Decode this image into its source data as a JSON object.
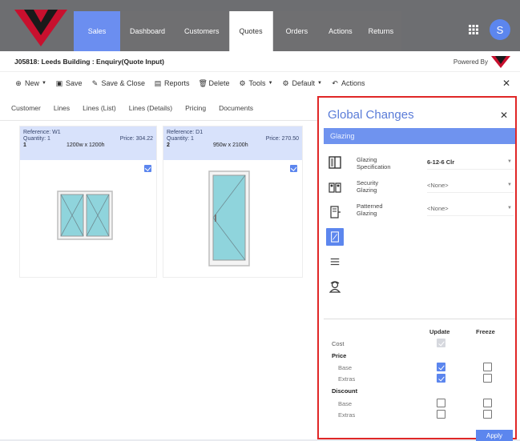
{
  "app": {
    "logo_icon": "company-logo",
    "nav_tabs": [
      "Sales",
      "Dashboard",
      "Customers",
      "Quotes",
      "Orders",
      "Actions",
      "Returns"
    ],
    "active_tab": "Quotes",
    "apps_icon": "grid-icon",
    "avatar_initial": "S",
    "accent_color": "#5c86ee"
  },
  "header": {
    "title": "J05818: Leeds Building : Enquiry(Quote Input)",
    "powered_by": "Powered By"
  },
  "toolbar": {
    "new": "New",
    "save": "Save",
    "save_close": "Save & Close",
    "reports": "Reports",
    "delete": "Delete",
    "tools": "Tools",
    "default": "Default",
    "actions": "Actions"
  },
  "subtabs": [
    "Customer",
    "Lines",
    "Lines (List)",
    "Lines (Details)",
    "Pricing",
    "Documents"
  ],
  "lines": [
    {
      "reference": "Reference: W1",
      "quantity": "Quantity: 1",
      "price": "Price: 304.22",
      "number": "1",
      "size": "1200w x 1200h",
      "selected": true
    },
    {
      "reference": "Reference: D1",
      "quantity": "Quantity: 1",
      "price": "Price: 270.50",
      "number": "2",
      "size": "950w x 2100h",
      "selected": true
    }
  ],
  "panel": {
    "title": "Global Changes",
    "section": "Glazing",
    "options": [
      {
        "label1": "Glazing",
        "label2": "Specification",
        "value": "6-12-6 Clr",
        "bold": true
      },
      {
        "label1": "Security",
        "label2": "Glazing",
        "value": "<None>",
        "bold": false
      },
      {
        "label1": "Patterned",
        "label2": "Glazing",
        "value": "<None>",
        "bold": false
      }
    ],
    "rail_icons": [
      "glazing-icon",
      "security-glazing-icon",
      "patterned-glazing-icon",
      "selected-option-icon",
      "list-icon",
      "fitter-icon"
    ],
    "col_update": "Update",
    "col_freeze": "Freeze",
    "rows": {
      "cost": "Cost",
      "price": "Price",
      "base1": "Base",
      "extras1": "Extras",
      "discount": "Discount",
      "base2": "Base",
      "extras2": "Extras"
    },
    "checks": {
      "cost_update": "disabled",
      "price_base_update": true,
      "price_base_freeze": false,
      "price_extras_update": true,
      "price_extras_freeze": false,
      "discount_base_update": false,
      "discount_base_freeze": false,
      "discount_extras_update": false,
      "discount_extras_freeze": false
    },
    "apply": "Apply"
  }
}
